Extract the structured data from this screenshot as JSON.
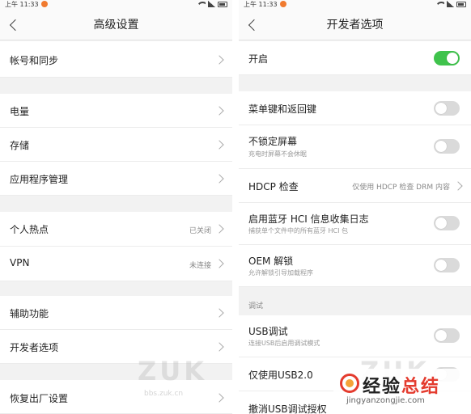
{
  "status": {
    "time": "上午 11:33"
  },
  "left": {
    "title": "高级设置",
    "items": [
      {
        "label": "帐号和同步"
      },
      {
        "label": "电量"
      },
      {
        "label": "存储"
      },
      {
        "label": "应用程序管理"
      },
      {
        "label": "个人热点",
        "value": "已关闭"
      },
      {
        "label": "VPN",
        "value": "未连接"
      },
      {
        "label": "辅助功能"
      },
      {
        "label": "开发者选项"
      },
      {
        "label": "恢复出厂设置"
      }
    ]
  },
  "right": {
    "title": "开发者选项",
    "items": [
      {
        "label": "开启",
        "toggle": true
      },
      {
        "label": "菜单键和返回键",
        "toggle": false
      },
      {
        "label": "不锁定屏幕",
        "sub": "充电时屏幕不会休眠",
        "toggle": false
      },
      {
        "label": "HDCP 检查",
        "value": "仅使用 HDCP 检查 DRM 内容"
      },
      {
        "label": "启用蓝牙 HCI 信息收集日志",
        "sub": "捕获单个文件中的所有蓝牙 HCI 包",
        "toggle": false
      },
      {
        "label": "OEM 解锁",
        "sub": "允许解锁引导加载程序",
        "toggle": false
      },
      {
        "label": "USB调试",
        "sub": "连接USB后启用调试模式",
        "toggle": false
      },
      {
        "label": "仅使用USB2.0",
        "toggle": false
      },
      {
        "label": "撤消USB调试授权"
      }
    ],
    "section_debug": "调试"
  },
  "watermark": {
    "text": "ZUK",
    "url": "bbs.zuk.cn"
  },
  "brand": {
    "cn_a": "经验",
    "cn_b": "总结",
    "en": "jingyanzongjie.com"
  },
  "colors": {
    "toggle_on": "#3fc34c",
    "brand_red": "#e43b2e"
  }
}
